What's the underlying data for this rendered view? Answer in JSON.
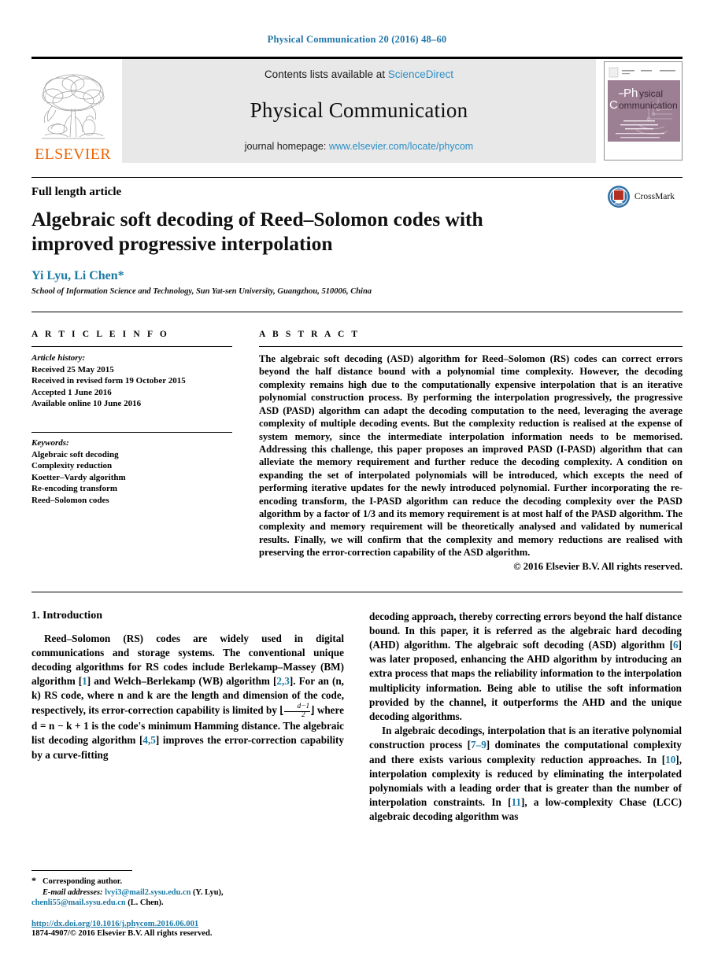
{
  "running_head": "Physical Communication 20 (2016) 48–60",
  "masthead": {
    "publisher_name": "ELSEVIER",
    "contents_prefix": "Contents lists available at ",
    "contents_link": "ScienceDirect",
    "journal_title": "Physical Communication",
    "homepage_prefix": "journal homepage: ",
    "homepage_url": "www.elsevier.com/locate/phycom",
    "cover_title_line1": "Physical",
    "cover_title_line2": "Communication"
  },
  "title_block": {
    "article_type": "Full length article",
    "title": "Algebraic soft decoding of Reed–Solomon codes with improved progressive interpolation",
    "authors": "Yi Lyu, Li Chen",
    "corresponding_marker": "*",
    "affiliation": "School of Information Science and Technology, Sun Yat-sen University, Guangzhou, 510006, China",
    "crossmark_label": "CrossMark"
  },
  "article_info": {
    "heading": "A R T I C L E   I N F O",
    "history_title": "Article history:",
    "history": [
      "Received 25 May 2015",
      "Received in revised form 19 October 2015",
      "Accepted 1 June 2016",
      "Available online 10 June 2016"
    ],
    "keywords_title": "Keywords:",
    "keywords": [
      "Algebraic soft decoding",
      "Complexity reduction",
      "Koetter–Vardy algorithm",
      "Re-encoding transform",
      "Reed–Solomon codes"
    ]
  },
  "abstract": {
    "heading": "A B S T R A C T",
    "text": "The algebraic soft decoding (ASD) algorithm for Reed–Solomon (RS) codes can correct errors beyond the half distance bound with a polynomial time complexity. However, the decoding complexity remains high due to the computationally expensive interpolation that is an iterative polynomial construction process. By performing the interpolation progressively, the progressive ASD (PASD) algorithm can adapt the decoding computation to the need, leveraging the average complexity of multiple decoding events. But the complexity reduction is realised at the expense of system memory, since the intermediate interpolation information needs to be memorised. Addressing this challenge, this paper proposes an improved PASD (I-PASD) algorithm that can alleviate the memory requirement and further reduce the decoding complexity. A condition on expanding the set of interpolated polynomials will be introduced, which excepts the need of performing iterative updates for the newly introduced polynomial. Further incorporating the re-encoding transform, the I-PASD algorithm can reduce the decoding complexity over the PASD algorithm by a factor of 1/3 and its memory requirement is at most half of the PASD algorithm. The complexity and memory requirement will be theoretically analysed and validated by numerical results. Finally, we will confirm that the complexity and memory reductions are realised with preserving the error-correction capability of the ASD algorithm.",
    "copyright": "© 2016 Elsevier B.V. All rights reserved."
  },
  "body": {
    "section_number_title": "1.  Introduction",
    "left_par1_a": "Reed–Solomon (RS) codes are widely used in digital communications and storage systems. The conventional unique decoding algorithms for RS codes include Berlekamp–Massey (BM) algorithm [",
    "left_par1_cite1": "1",
    "left_par1_b": "] and Welch–Berlekamp (WB) algorithm [",
    "left_par1_cite2": "2,3",
    "left_par1_c": "]. For an (n, k) RS code, where n and k are the length and dimension of the code, respectively, its error-correction capability is limited by ⌊",
    "left_par1_frac_num": "d−1",
    "left_par1_frac_den": "2",
    "left_par1_d": "⌋ where d = n − k + 1 is the code's minimum Hamming distance. The algebraic list decoding algorithm [",
    "left_par1_cite3": "4,5",
    "left_par1_e": "] improves the error-correction capability by a curve-fitting",
    "right_par1_a": "decoding approach, thereby correcting errors beyond the half distance bound. In this paper, it is referred as the algebraic hard decoding (AHD) algorithm. The algebraic soft decoding (ASD) algorithm [",
    "right_par1_cite1": "6",
    "right_par1_b": "] was later proposed, enhancing the AHD algorithm by introducing an extra process that maps the reliability information to the interpolation multiplicity information. Being able to utilise the soft information provided by the channel, it outperforms the AHD and the unique decoding algorithms.",
    "right_par2_a": "In algebraic decodings, interpolation that is an iterative polynomial construction process [",
    "right_par2_cite1": "7–9",
    "right_par2_b": "] dominates the computational complexity and there exists various complexity reduction approaches. In [",
    "right_par2_cite2": "10",
    "right_par2_c": "], interpolation complexity is reduced by eliminating the interpolated polynomials with a leading order that is greater than the number of interpolation constraints. In [",
    "right_par2_cite3": "11",
    "right_par2_d": "], a low-complexity Chase (LCC) algebraic decoding algorithm was"
  },
  "footnote": {
    "corresponding_marker": "*",
    "corresponding_text": "Corresponding author.",
    "emails_label": "E-mail addresses:",
    "email1": "lvyi3@mail2.sysu.edu.cn",
    "email1_name": "(Y. Lyu),",
    "email2": "chenli55@mail.sysu.edu.cn",
    "email2_name": "(L. Chen).",
    "doi": "http://dx.doi.org/10.1016/j.phycom.2016.06.001",
    "issn_line": "1874-4907/© 2016 Elsevier B.V. All rights reserved."
  },
  "colors": {
    "link": "#1c7aa5",
    "elsevier_orange": "#ec6707",
    "sciencedirect_blue": "#2b8ec4",
    "banner_gray": "#e8e8e8",
    "cover_mauve": "#9d7f94"
  }
}
